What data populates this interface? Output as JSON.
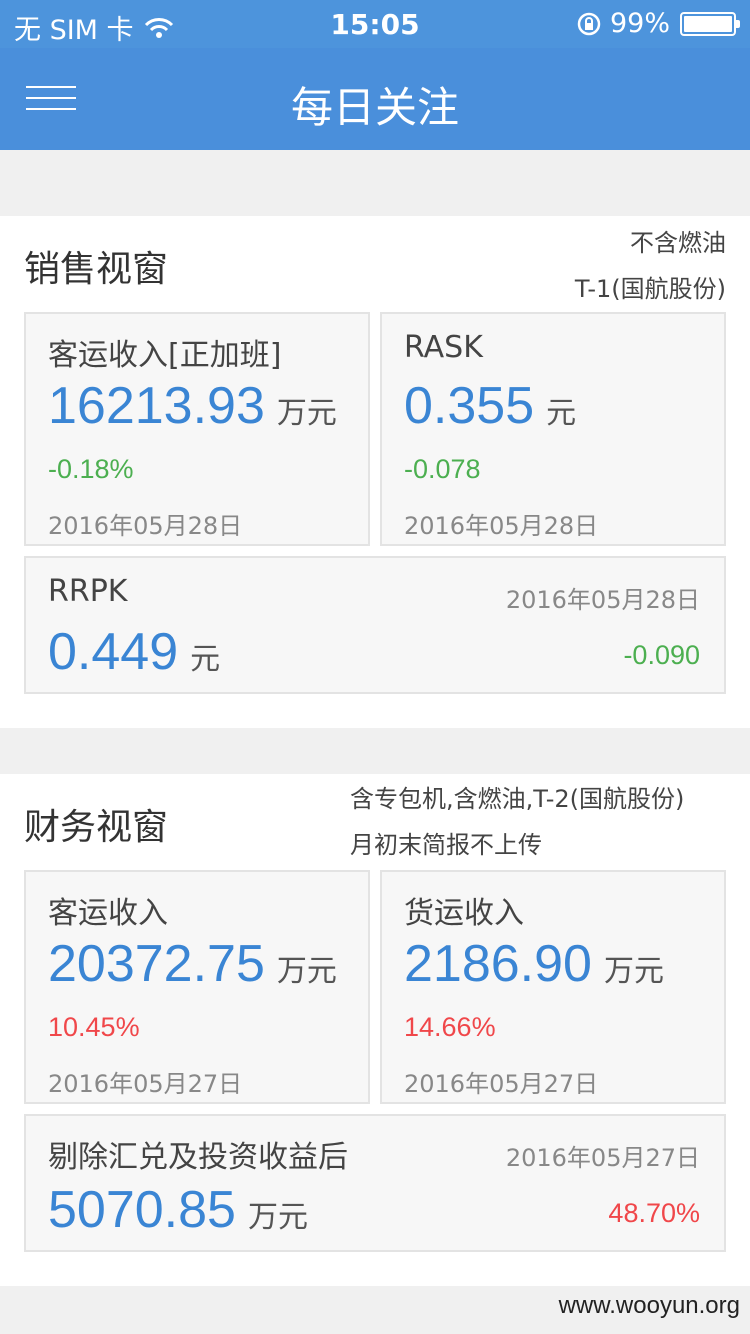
{
  "status_bar": {
    "carrier": "无 SIM 卡",
    "time": "15:05",
    "battery_percent": "99%",
    "battery_level": 0.99
  },
  "nav": {
    "title": "每日关注"
  },
  "sales": {
    "title": "销售视窗",
    "note_line1": "不含燃油",
    "note_line2": "T-1(国航股份)",
    "card1": {
      "label": "客运收入[正加班]",
      "value": "16213.93",
      "unit": "万元",
      "change": "-0.18%",
      "date": "2016年05月28日"
    },
    "card2": {
      "label": "RASK",
      "value": "0.355",
      "unit": "元",
      "change": "-0.078",
      "date": "2016年05月28日"
    },
    "card3": {
      "label": "RRPK",
      "value": "0.449",
      "unit": "元",
      "change": "-0.090",
      "date": "2016年05月28日"
    }
  },
  "finance": {
    "title": "财务视窗",
    "note_line1": "含专包机,含燃油,T-2(国航股份)",
    "note_line2": "月初末简报不上传",
    "card1": {
      "label": "客运收入",
      "value": "20372.75",
      "unit": "万元",
      "change": "10.45%",
      "date": "2016年05月27日"
    },
    "card2": {
      "label": "货运收入",
      "value": "2186.90",
      "unit": "万元",
      "change": "14.66%",
      "date": "2016年05月27日"
    },
    "card3": {
      "label": "剔除汇兑及投资收益后",
      "value": "5070.85",
      "unit": "万元",
      "change": "48.70%",
      "date": "2016年05月27日"
    }
  },
  "watermark": "www.wooyun.org"
}
